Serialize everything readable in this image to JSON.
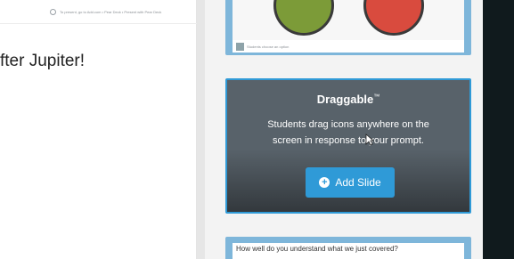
{
  "left_panel": {
    "topbar_text": "To present, go to Add.com • Pear Deck • Present with Pear Deck",
    "slide_title": "fter Jupiter!"
  },
  "gallery": {
    "top_card": {
      "caption": "Students choose an option"
    },
    "draggable_card": {
      "title": "Draggable",
      "trademark": "™",
      "description_line1": "Students drag icons anywhere on the",
      "description_line2": "screen in response to your prompt.",
      "add_slide_label": "Add Slide"
    },
    "bottom_card": {
      "question": "How well do you understand what we just covered?"
    }
  },
  "colors": {
    "accent": "#2f9ad7",
    "card_frame": "#7eb6da",
    "card_dark": "#58626a",
    "right_panel": "#101a1d",
    "green": "#7c9b38",
    "red": "#d94b3e"
  },
  "icons": [
    "info-icon",
    "plus-icon",
    "cursor-icon"
  ]
}
